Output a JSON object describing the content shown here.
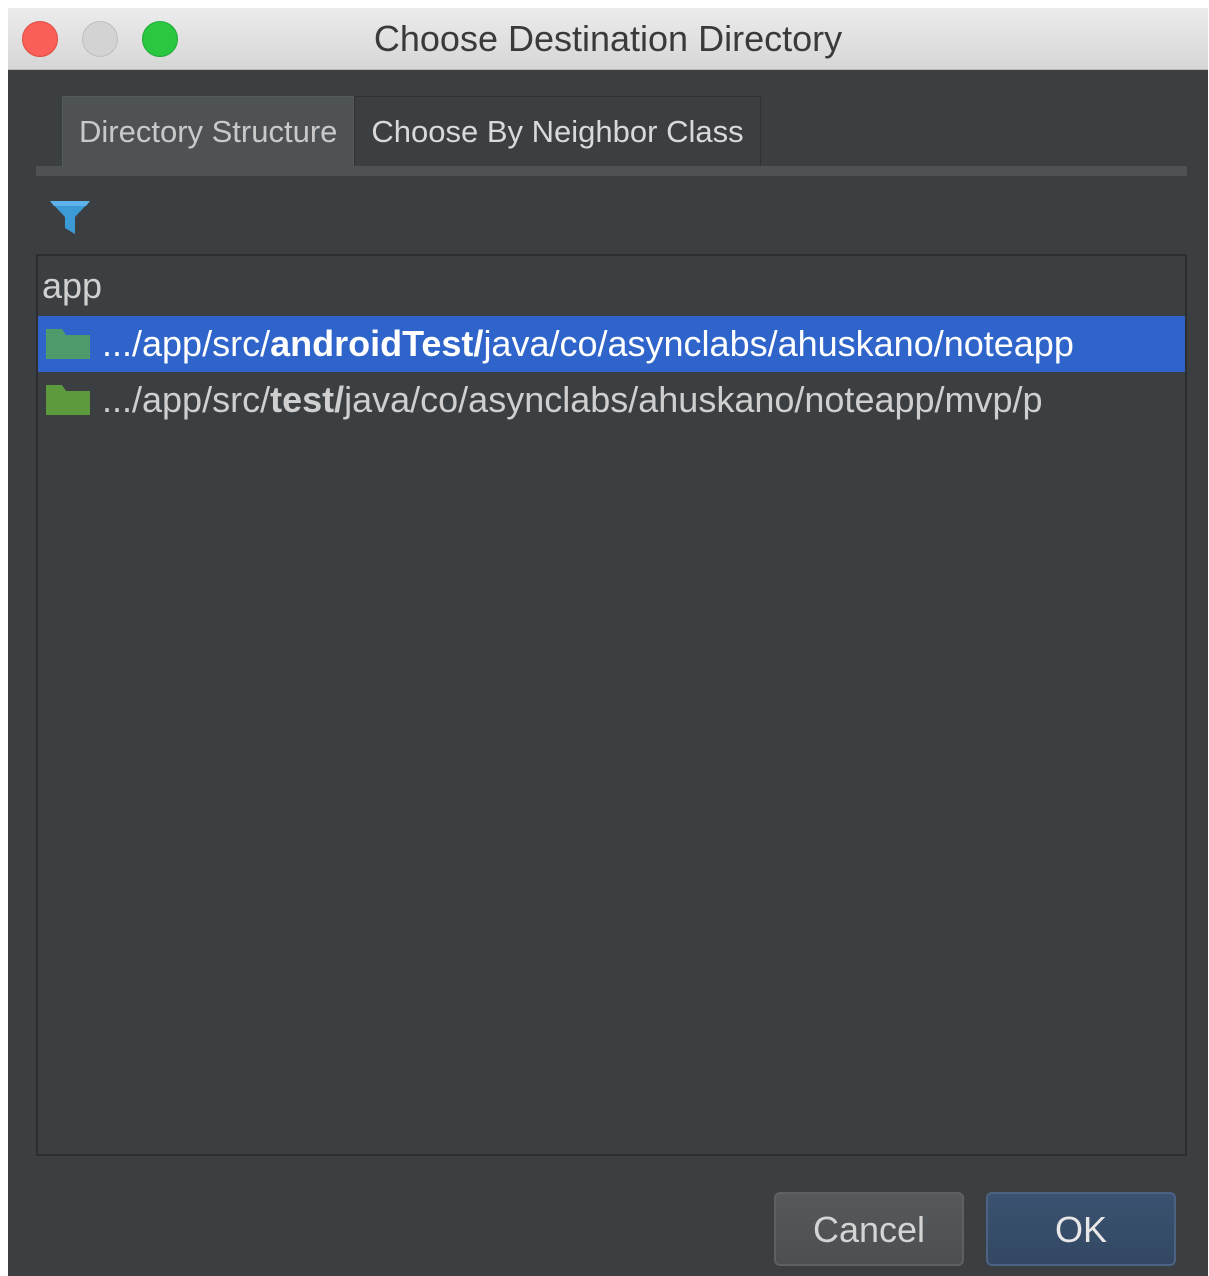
{
  "window": {
    "title": "Choose Destination Directory"
  },
  "tabs": [
    {
      "label": "Directory Structure",
      "active": true
    },
    {
      "label": "Choose By Neighbor Class",
      "active": false
    }
  ],
  "toolbar": {
    "filter_icon": "filter-icon"
  },
  "tree": {
    "root_label": "app",
    "rows": [
      {
        "selected": true,
        "icon": "folder-icon",
        "prefix": ".../app/src/",
        "highlight": "androidTest/",
        "suffix": "java/co/asynclabs/ahuskano/noteapp"
      },
      {
        "selected": false,
        "icon": "folder-icon",
        "prefix": ".../app/src/",
        "highlight": "test/",
        "suffix": "java/co/asynclabs/ahuskano/noteapp/mvp/p"
      }
    ]
  },
  "buttons": {
    "cancel_label": "Cancel",
    "ok_label": "OK"
  },
  "colors": {
    "background": "#3c3f41",
    "selection": "#2f65ca",
    "folder_selected": "#4f9a6b",
    "folder_normal": "#5d9a3d",
    "filter_icon": "#3c9ad6"
  }
}
